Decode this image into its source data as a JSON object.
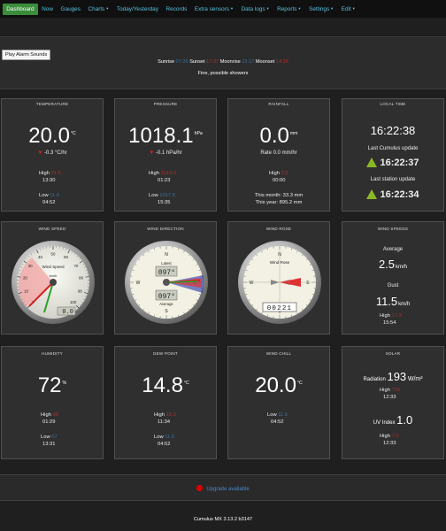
{
  "nav": {
    "items": [
      {
        "label": "Dashboard",
        "dropdown": false,
        "active": true
      },
      {
        "label": "Now",
        "dropdown": false,
        "active": false
      },
      {
        "label": "Gauges",
        "dropdown": false,
        "active": false
      },
      {
        "label": "Charts",
        "dropdown": true,
        "active": false
      },
      {
        "label": "Today/Yesterday",
        "dropdown": false,
        "active": false
      },
      {
        "label": "Records",
        "dropdown": false,
        "active": false
      },
      {
        "label": "Extra sensors",
        "dropdown": true,
        "active": false
      },
      {
        "label": "Data logs",
        "dropdown": true,
        "active": false
      },
      {
        "label": "Reports",
        "dropdown": true,
        "active": false
      },
      {
        "label": "Settings",
        "dropdown": true,
        "active": false
      },
      {
        "label": "Edit",
        "dropdown": true,
        "active": false
      }
    ]
  },
  "header": {
    "alarm_button": "Play Alarm Sounds",
    "sunrise_label": "Sunrise",
    "sunrise": "07:26",
    "sunset_label": "Sunset",
    "sunset": "17:37",
    "moonrise_label": "Moonrise",
    "moonrise": "22:17",
    "moonset_label": "Moonset",
    "moonset": "14:16",
    "forecast": "Fine, possible showers"
  },
  "temperature": {
    "title": "TEMPERATURE",
    "value": "20.0",
    "unit": "°C",
    "trend": "-0.3 °C/hr",
    "high_label": "High",
    "high_value": "21.5",
    "high_time": "13:30",
    "low_label": "Low",
    "low_value": "11.6",
    "low_time": "04:52"
  },
  "pressure": {
    "title": "PRESSURE",
    "value": "1018.1",
    "unit": "hPa",
    "trend": "-0.1 hPa/hr",
    "high_label": "High",
    "high_value": "1019.6",
    "high_time": "01:23",
    "low_label": "Low",
    "low_value": "1017.6",
    "low_time": "15:35"
  },
  "rainfall": {
    "title": "RAINFALL",
    "value": "0.0",
    "unit": "mm",
    "rate": "Rate 0.0 mm/hr",
    "high_label": "High",
    "high_value": "0.0",
    "high_time": "00:00",
    "month": "This month: 33.3 mm",
    "year": "This year: 895.2 mm"
  },
  "localtime": {
    "title": "LOCAL TIME",
    "time": "16:22:38",
    "cumulus_label": "Last Cumulus update",
    "cumulus_time": "16:22:37",
    "station_label": "Last station update",
    "station_time": "16:22:34"
  },
  "windspeed_gauge": {
    "title": "WIND SPEED",
    "gauge_label": "Wind Speed",
    "gauge_unit": "km/h",
    "value": 0.0,
    "max": 100,
    "ticks": [
      "0",
      "10",
      "20",
      "30",
      "40",
      "50",
      "60",
      "70",
      "80",
      "90",
      "100"
    ],
    "readout": "0.0"
  },
  "winddir_gauge": {
    "title": "WIND DIRECTION",
    "latest_label": "Latest",
    "latest": "097°",
    "average_label": "Average",
    "average": "097°",
    "compass": [
      "N",
      "E",
      "S",
      "W"
    ]
  },
  "windrose": {
    "title": "WIND ROSE",
    "label": "Wind Rose",
    "odometer": "00221",
    "compass": [
      "N",
      "E",
      "S",
      "W"
    ]
  },
  "windspeeds": {
    "title": "WIND SPEEDS",
    "average_label": "Average",
    "average_value": "2.5",
    "average_unit": "km/h",
    "gust_label": "Gust",
    "gust_value": "11.5",
    "gust_unit": "km/h",
    "high_label": "High",
    "high_value": "17.3",
    "high_time": "15:54"
  },
  "humidity": {
    "title": "HUMIDITY",
    "value": "72",
    "unit": "%",
    "high_label": "High",
    "high_value": "90",
    "high_time": "01:29",
    "low_label": "Low",
    "low_value": "67",
    "low_time": "13:31"
  },
  "dewpoint": {
    "title": "DEW POINT",
    "value": "14.8",
    "unit": "°C",
    "high_label": "High",
    "high_value": "16.2",
    "high_time": "11:34",
    "low_label": "Low",
    "low_value": "11.6",
    "low_time": "04:52"
  },
  "windchill": {
    "title": "WIND CHILL",
    "value": "20.0",
    "unit": "°C",
    "low_label": "Low",
    "low_value": "11.6",
    "low_time": "04:52"
  },
  "solar": {
    "title": "SOLAR",
    "radiation_label": "Radiation",
    "radiation_value": "193",
    "radiation_unit": "W/m²",
    "rad_high_label": "High",
    "rad_high_value": "715",
    "rad_high_time": "12:33",
    "uv_label": "UV Index",
    "uv_value": "1.0",
    "uv_high_label": "High",
    "uv_high_value": "7.0",
    "uv_high_time": "12:33"
  },
  "footer": {
    "upgrade": "Upgrade available",
    "version": "Cumulus MX 3.13.2 b3147"
  },
  "colors": {
    "accent_green": "#3b8c3b",
    "link_blue": "#5bc0de",
    "high_red": "#b52d2d",
    "low_blue": "#3a6fa6",
    "trend_up": "#8cb827"
  }
}
